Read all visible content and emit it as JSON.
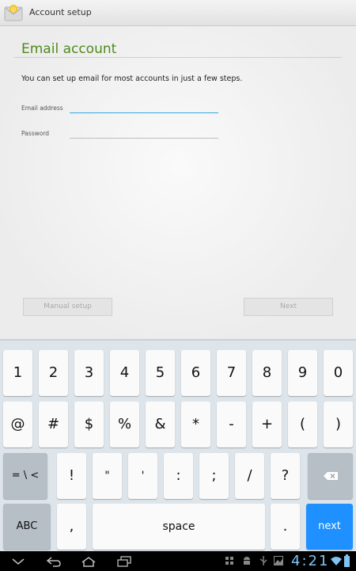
{
  "app": {
    "title": "Account setup"
  },
  "form": {
    "heading": "Email account",
    "intro": "You can set up email for most accounts in just a few steps.",
    "email_label": "Email address",
    "email_value": "",
    "password_label": "Password",
    "password_value": "",
    "manual_setup_label": "Manual setup",
    "next_label": "Next"
  },
  "keyboard": {
    "row1": [
      "1",
      "2",
      "3",
      "4",
      "5",
      "6",
      "7",
      "8",
      "9",
      "0"
    ],
    "row2": [
      "@",
      "#",
      "$",
      "%",
      "&",
      "*",
      "-",
      "+",
      "(",
      ")"
    ],
    "row3": [
      "!",
      "\"",
      "'",
      ":",
      ";",
      "/",
      "?"
    ],
    "alt_symbols_label": "= \\ <",
    "abc_label": "ABC",
    "comma": ",",
    "space_label": "space",
    "period": ".",
    "next_label": "next"
  },
  "status_bar": {
    "time": "4:21"
  },
  "colors": {
    "accent_heading": "#4e8a1d",
    "focus_line": "#33a8de",
    "next_key": "#1e90ff",
    "clock": "#7fc4f4"
  }
}
